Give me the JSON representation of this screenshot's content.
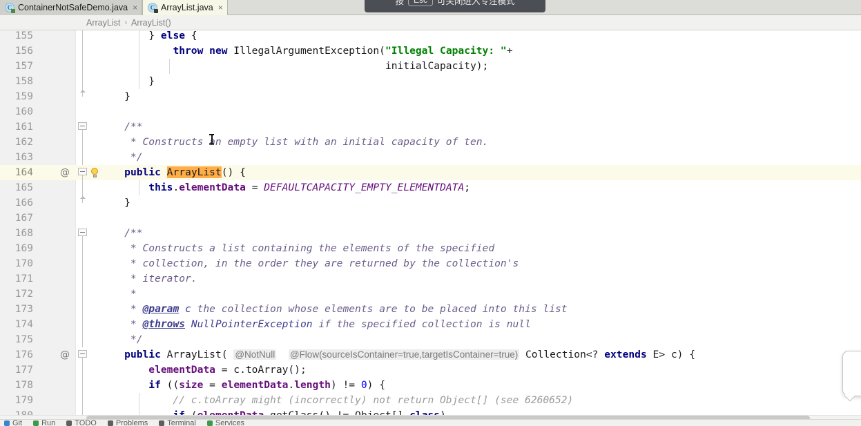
{
  "window": {
    "title": "ArrayList.java"
  },
  "tabs": [
    {
      "label": "ContainerNotSafeDemo.java",
      "icon": "java-class-icon",
      "active": false,
      "close": "×"
    },
    {
      "label": "ArrayList.java",
      "icon": "java-class-readonly-icon",
      "active": true,
      "close": "×"
    }
  ],
  "breadcrumb": {
    "separator": "›",
    "items": [
      "ArrayList",
      "ArrayList()"
    ]
  },
  "tooltip": {
    "text_before": "按",
    "key": "Esc",
    "text_after": "可关闭进入专注模式"
  },
  "editor": {
    "first_line": 155,
    "highlighted_line": 164,
    "caret_token": "an",
    "selection_token": "ArrayList",
    "colors": {
      "keyword": "#000080",
      "string": "#008000",
      "number": "#0000ff",
      "field": "#660e7a",
      "constant": "#660e7a",
      "javadoc": "#6b5d8a",
      "comment": "#9a9a9a",
      "selection_highlight": "#ffad46",
      "line_highlight": "#fcfae8",
      "inlay_hint_bg": "#ededed"
    },
    "lines": [
      {
        "n": 155,
        "text": "        } else {"
      },
      {
        "n": 156,
        "text": "            throw new IllegalArgumentException(\"Illegal Capacity: \"+"
      },
      {
        "n": 157,
        "text": "                                               initialCapacity);"
      },
      {
        "n": 158,
        "text": "        }"
      },
      {
        "n": 159,
        "text": "    }"
      },
      {
        "n": 160,
        "text": ""
      },
      {
        "n": 161,
        "text": "    /**"
      },
      {
        "n": 162,
        "text": "     * Constructs an empty list with an initial capacity of ten."
      },
      {
        "n": 163,
        "text": "     */"
      },
      {
        "n": 164,
        "text": "    public ArrayList() {"
      },
      {
        "n": 165,
        "text": "        this.elementData = DEFAULTCAPACITY_EMPTY_ELEMENTDATA;"
      },
      {
        "n": 166,
        "text": "    }"
      },
      {
        "n": 167,
        "text": ""
      },
      {
        "n": 168,
        "text": "    /**"
      },
      {
        "n": 169,
        "text": "     * Constructs a list containing the elements of the specified"
      },
      {
        "n": 170,
        "text": "     * collection, in the order they are returned by the collection's"
      },
      {
        "n": 171,
        "text": "     * iterator."
      },
      {
        "n": 172,
        "text": "     *"
      },
      {
        "n": 173,
        "text": "     * @param c the collection whose elements are to be placed into this list"
      },
      {
        "n": 174,
        "text": "     * @throws NullPointerException if the specified collection is null"
      },
      {
        "n": 175,
        "text": "     */"
      },
      {
        "n": 176,
        "text": "    public ArrayList( @NotNull  @Flow(sourceIsContainer=true,targetIsContainer=true) Collection<? extends E> c) {"
      },
      {
        "n": 177,
        "text": "        elementData = c.toArray();"
      },
      {
        "n": 178,
        "text": "        if ((size = elementData.length) != 0) {"
      },
      {
        "n": 179,
        "text": "            // c.toArray might (incorrectly) not return Object[] (see 6260652)"
      },
      {
        "n": 180,
        "text": "            if (elementData.getClass() != Object[].class)"
      }
    ],
    "gutter_markers": [
      {
        "line": 164,
        "marker": "@",
        "name": "override-marker"
      },
      {
        "line": 176,
        "marker": "@",
        "name": "override-marker"
      }
    ],
    "inlay_hints": [
      "@NotNull",
      "@Flow(sourceIsContainer=true,targetIsContainer=true)"
    ]
  },
  "statusbar": {
    "items": [
      "Git",
      "Run",
      "TODO",
      "Problems",
      "Terminal",
      "Services"
    ]
  },
  "scrollbar": {
    "orientation": "horizontal"
  }
}
